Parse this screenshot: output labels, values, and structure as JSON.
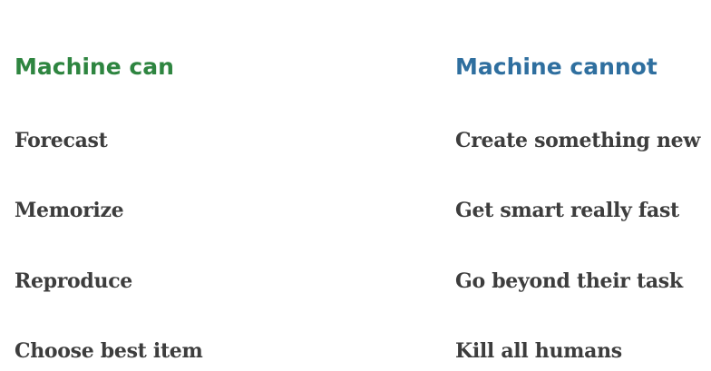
{
  "left_column": {
    "heading": "Machine can",
    "items": [
      "Forecast",
      "Memorize",
      "Reproduce",
      "Choose best item"
    ]
  },
  "right_column": {
    "heading": "Machine cannot",
    "items": [
      "Create something new",
      "Get smart really fast",
      "Go beyond their task",
      "Kill all humans"
    ]
  },
  "colors": {
    "left_heading": "#2e8540",
    "right_heading": "#2f6f9f",
    "item_text": "#3d3d3d",
    "background": "#ffffff"
  }
}
